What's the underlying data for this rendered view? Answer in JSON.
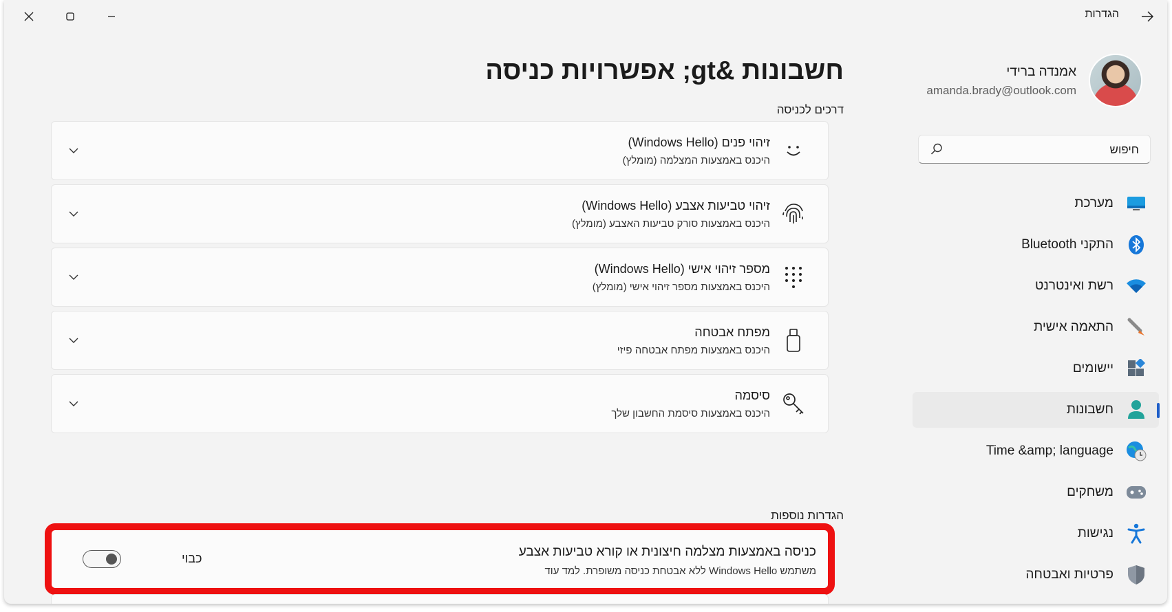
{
  "window": {
    "app_title": "הגדרות"
  },
  "profile": {
    "name": "אמנדה ברידי",
    "email": "amanda.brady@outlook.com"
  },
  "search": {
    "placeholder": "חיפוש"
  },
  "nav": {
    "items": [
      {
        "label": "מערכת",
        "icon": "monitor-icon"
      },
      {
        "label": "התקני Bluetooth",
        "icon": "bluetooth-icon"
      },
      {
        "label": "רשת ואינטרנט",
        "icon": "wifi-icon"
      },
      {
        "label": "התאמה אישית",
        "icon": "brush-icon"
      },
      {
        "label": "יישומים",
        "icon": "apps-icon"
      },
      {
        "label": "חשבונות",
        "icon": "person-icon",
        "active": true
      },
      {
        "label": "Time &amp; language",
        "icon": "globe-clock-icon"
      },
      {
        "label": "משחקים",
        "icon": "gamepad-icon"
      },
      {
        "label": "נגישות",
        "icon": "accessibility-icon"
      },
      {
        "label": "פרטיות ואבטחה",
        "icon": "shield-icon"
      }
    ]
  },
  "main": {
    "title": "חשבונות &gt; אפשרויות כניסה",
    "ways_label": "דרכים לכניסה",
    "options": [
      {
        "title": "זיהוי פנים (Windows Hello)",
        "subtitle": "היכנס באמצעות המצלמה (מומלץ)",
        "icon": "smiley-icon"
      },
      {
        "title": "זיהוי טביעות אצבע (Windows Hello)",
        "subtitle": "היכנס באמצעות סורק טביעות האצבע (מומלץ)",
        "icon": "fingerprint-icon"
      },
      {
        "title": "מספר זיהוי אישי (Windows Hello)",
        "subtitle": "היכנס באמצעות מספר זיהוי אישי (מומלץ)",
        "icon": "keypad-icon"
      },
      {
        "title": "מפתח אבטחה",
        "subtitle": "היכנס באמצעות מפתח אבטחה פיזי",
        "icon": "usb-key-icon"
      },
      {
        "title": "סיסמה",
        "subtitle": "היכנס באמצעות סיסמת החשבון שלך",
        "icon": "key-icon"
      }
    ],
    "additional_label": "הגדרות נוספות",
    "external": {
      "title": "כניסה באמצעות מצלמה חיצונית או קורא טביעות אצבע",
      "subtitle": "משתמש Windows Hello ללא אבטחת כניסה משופרת. למד עוד",
      "toggle_label": "כבוי"
    }
  }
}
